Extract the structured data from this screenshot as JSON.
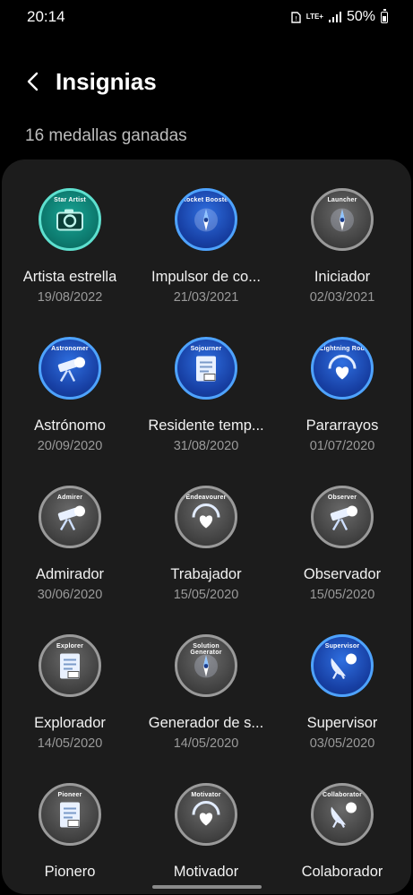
{
  "status_bar": {
    "time": "20:14",
    "network_label": "LTE+",
    "battery": "50%",
    "icons": [
      "sim-alert-icon",
      "lte-icon",
      "signal-icon",
      "battery-icon"
    ]
  },
  "header": {
    "title": "Insignias",
    "back_icon": "back-arrow-icon"
  },
  "summary": {
    "count_text": "16 medallas ganadas"
  },
  "colors": {
    "background": "#000000",
    "card": "#1c1c1c",
    "date": "#9a9a9a"
  },
  "badges": [
    {
      "name": "Artista estrella",
      "date": "19/08/2022",
      "ring": "Star Artist",
      "style": "teal",
      "icon": "camera-icon"
    },
    {
      "name": "Impulsor de co...",
      "date": "21/03/2021",
      "ring": "Rocket Booster",
      "style": "blue",
      "icon": "compass-icon"
    },
    {
      "name": "Iniciador",
      "date": "02/03/2021",
      "ring": "Launcher",
      "style": "gray",
      "icon": "compass-icon"
    },
    {
      "name": "Astrónomo",
      "date": "20/09/2020",
      "ring": "Astronomer",
      "style": "blue",
      "icon": "telescope-icon"
    },
    {
      "name": "Residente temp...",
      "date": "31/08/2020",
      "ring": "Sojourner",
      "style": "blue",
      "icon": "notepad-icon"
    },
    {
      "name": "Pararrayos",
      "date": "01/07/2020",
      "ring": "Lightning Rod",
      "style": "blue",
      "icon": "heart-icon"
    },
    {
      "name": "Admirador",
      "date": "30/06/2020",
      "ring": "Admirer",
      "style": "gray",
      "icon": "telescope-icon"
    },
    {
      "name": "Trabajador",
      "date": "15/05/2020",
      "ring": "Endeavourer",
      "style": "gray",
      "icon": "heart-icon"
    },
    {
      "name": "Observador",
      "date": "15/05/2020",
      "ring": "Observer",
      "style": "gray",
      "icon": "telescope-icon"
    },
    {
      "name": "Explorador",
      "date": "14/05/2020",
      "ring": "Explorer",
      "style": "gray",
      "icon": "notepad-icon"
    },
    {
      "name": "Generador de s...",
      "date": "14/05/2020",
      "ring": "Solution Generator",
      "style": "gray",
      "icon": "compass-icon"
    },
    {
      "name": "Supervisor",
      "date": "03/05/2020",
      "ring": "Supervisor",
      "style": "blue",
      "icon": "satellite-dish-icon"
    },
    {
      "name": "Pionero",
      "date": "",
      "ring": "Pioneer",
      "style": "gray",
      "icon": "notepad-icon"
    },
    {
      "name": "Motivador",
      "date": "",
      "ring": "Motivator",
      "style": "gray",
      "icon": "heart-icon"
    },
    {
      "name": "Colaborador",
      "date": "",
      "ring": "Collaborator",
      "style": "gray",
      "icon": "satellite-dish-icon"
    }
  ]
}
